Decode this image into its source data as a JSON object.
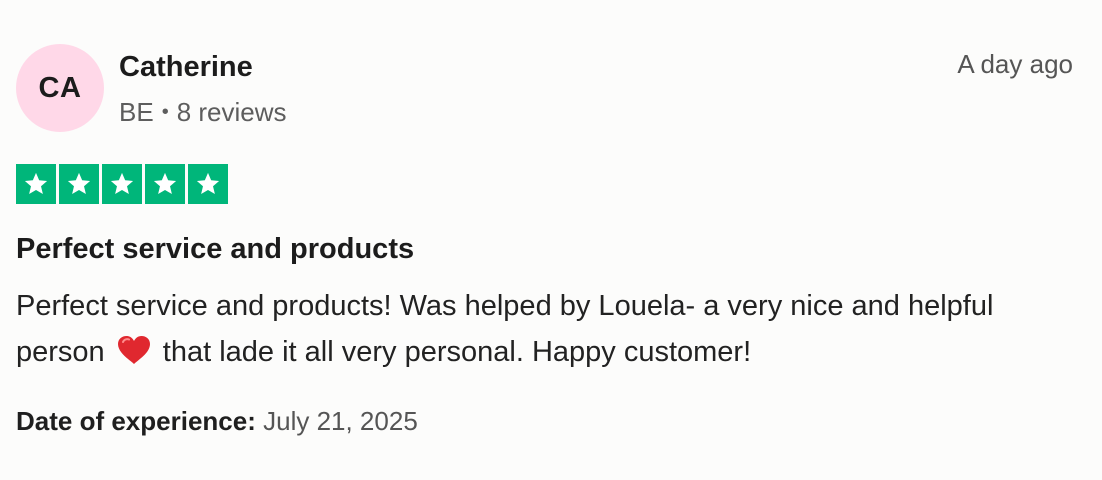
{
  "reviewer": {
    "initials": "CA",
    "name": "Catherine",
    "country": "BE",
    "review_count": "8 reviews",
    "avatar_color": "#ffd8e8"
  },
  "review": {
    "time_ago": "A day ago",
    "rating": 5,
    "rating_max": 5,
    "star_color": "#00b67a",
    "title": "Perfect service and products",
    "body_part1": "Perfect service and products! Was helped by Louela- a very nice and helpful person",
    "body_emoji": "heart-icon",
    "body_part2": "that lade it all very personal. Happy customer!",
    "experience_label": "Date of experience:",
    "experience_date": "July 21, 2025"
  },
  "icons": {
    "star": "star-icon",
    "meta_separator": "•"
  }
}
